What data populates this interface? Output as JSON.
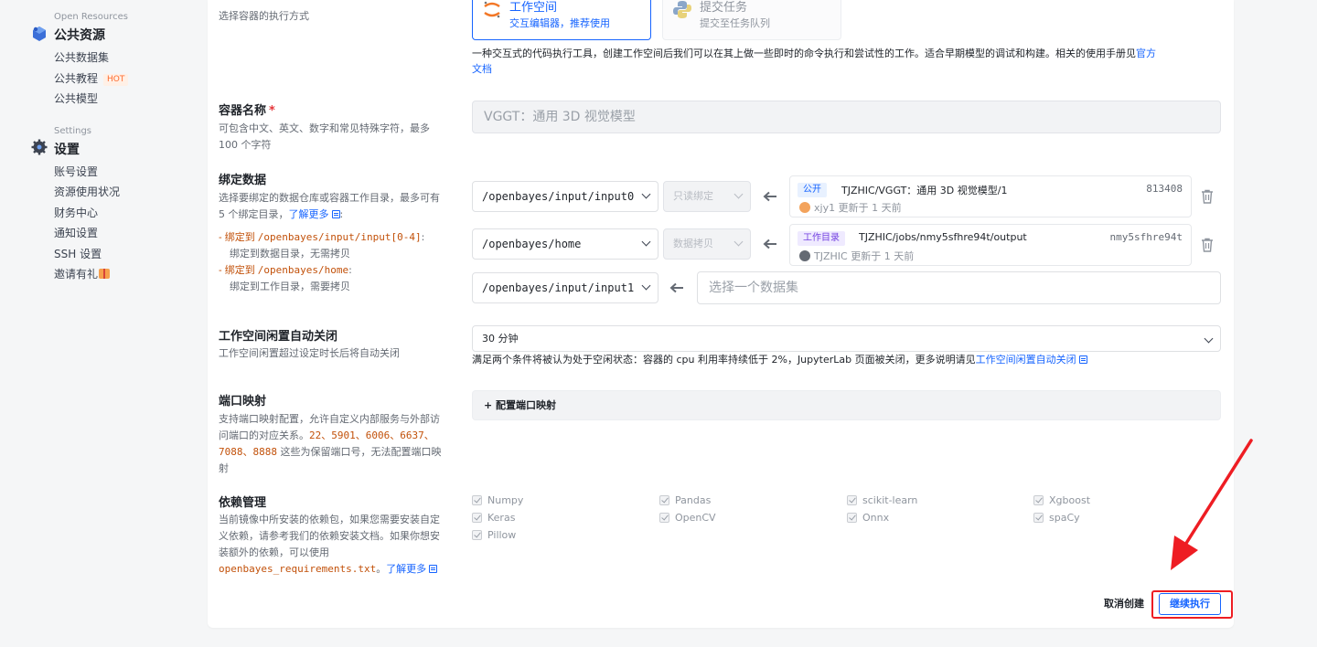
{
  "sidebar": {
    "open_resources": {
      "en": "Open Resources",
      "title": "公共资源",
      "items": [
        "公共数据集",
        "公共教程",
        "公共模型"
      ],
      "hot_badge": "HOT"
    },
    "settings": {
      "en": "Settings",
      "title": "设置",
      "items": [
        "账号设置",
        "资源使用状况",
        "财务中心",
        "通知设置",
        "SSH 设置",
        "邀请有礼"
      ]
    }
  },
  "type_section": {
    "hint": "选择容器的执行方式",
    "workspace": {
      "title": "工作空间",
      "subtitle": "交互编辑器，推荐使用"
    },
    "task": {
      "title": "提交任务",
      "subtitle": "提交至任务队列"
    },
    "description_prefix": "一种交互式的代码执行工具，创建工作空间后我们可以在其上做一些即时的命令执行和尝试性的工作。适合早期模型的调试和构建。相关的使用手册见",
    "description_link_1": "官方",
    "description_link_2": "文档"
  },
  "container_name": {
    "label": "容器名称",
    "required_mark": "*",
    "desc_line1": "可包含中文、英文、数字和常见特殊字符，最多",
    "desc_line2": "100 个字符",
    "value": "VGGT：通用 3D 视觉模型"
  },
  "bind_data": {
    "label": "绑定数据",
    "desc_line1": "选择要绑定的数据仓库或容器工作目录，最多可有",
    "desc_line2_prefix": "5 个绑定目录，",
    "learn_more": "了解更多",
    "desc_line2_suffix": ":",
    "rule1_prefix": "- 绑定到 ",
    "rule1_path": "/openbayes/input/input[0-4]",
    "rule1_colon": ":",
    "rule1_desc": "绑定到数据目录，无需拷贝",
    "rule2_prefix": "- 绑定到 ",
    "rule2_path": "/openbayes/home",
    "rule2_colon": ":",
    "rule2_desc": "绑定到工作目录，需要拷贝",
    "rows": [
      {
        "path": "/openbayes/input/input0",
        "mode": "只读绑定",
        "badge": "公开",
        "name": "TJZHIC/VGGT：通用 3D 视觉模型/1",
        "id": "813408",
        "user": "xjy1",
        "updated": "更新于 1 天前"
      },
      {
        "path": "/openbayes/home",
        "mode": "数据拷贝",
        "badge": "工作目录",
        "name": "TJZHIC/jobs/nmy5sfhre94t/output",
        "id": "nmy5sfhre94t",
        "user": "TJZHIC",
        "updated": "更新于 1 天前"
      }
    ],
    "empty_row": {
      "path": "/openbayes/input/input1",
      "placeholder": "选择一个数据集"
    }
  },
  "idle": {
    "label": "工作空间闲置自动关闭",
    "desc": "工作空间闲置超过设定时长后将自动关闭",
    "value": "30 分钟",
    "note_prefix": "满足两个条件将被认为处于空闲状态：容器的 cpu 利用率持续低于 2%，JupyterLab 页面被关闭，更多说明请见",
    "note_link": "工作空间闲置自动关闭"
  },
  "ports": {
    "label": "端口映射",
    "desc_line1": "支持端口映射配置，允许自定义内部服务与外部访",
    "desc_line2_prefix": "问端口的对应关系。",
    "ports_a": "22、5901、6006、6637、",
    "ports_b": "7088、8888",
    "desc_line3_suffix": " 这些为保留端口号，无法配置端口映",
    "desc_line4": "射",
    "button": "+ 配置端口映射"
  },
  "deps": {
    "label": "依赖管理",
    "desc_line1": "当前镜像中所安装的依赖包，如果您需要安装自定",
    "desc_line2": "义依赖，请参考我们的依赖安装文档。如果你想安",
    "desc_line3": "装额外的依赖，可以使用",
    "req_file": "openbayes_requirements.txt",
    "punct": "。",
    "learn_more": "了解更多",
    "packages": [
      "Numpy",
      "Pandas",
      "scikit-learn",
      "Xgboost",
      "Keras",
      "OpenCV",
      "Onnx",
      "spaCy",
      "Pillow"
    ]
  },
  "actions": {
    "cancel": "取消创建",
    "continue": "继续执行"
  },
  "colors": {
    "accent": "#1664ff",
    "annotation": "#ee1d23",
    "reserved_code": "#c2510a"
  }
}
